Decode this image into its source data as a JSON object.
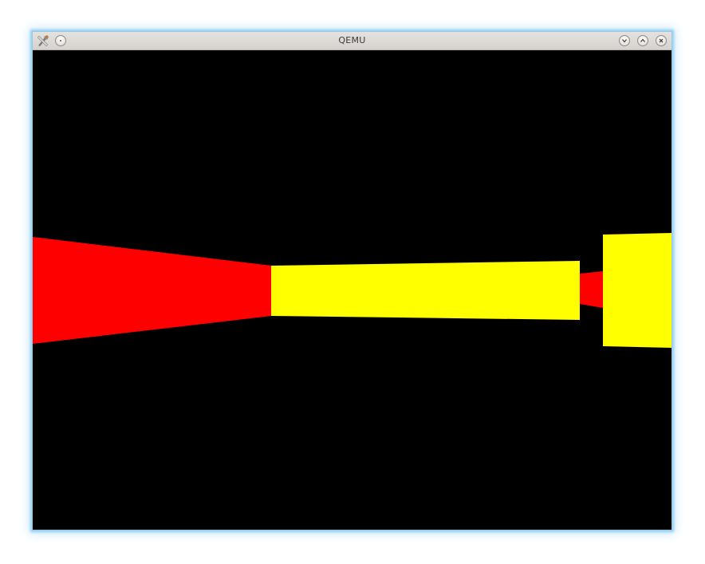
{
  "window": {
    "title": "QEMU"
  },
  "titlebar": {
    "app_icon": "qemu-tools-icon",
    "left_buttons": [
      {
        "name": "menu-button",
        "icon": "dot-icon"
      }
    ],
    "right_buttons": [
      {
        "name": "minimize-button",
        "icon": "chevron-down-icon"
      },
      {
        "name": "maximize-button",
        "icon": "chevron-up-icon"
      },
      {
        "name": "close-button",
        "icon": "close-icon"
      }
    ]
  },
  "scene": {
    "background_color": "#000000",
    "wall_colors": [
      "#ff0000",
      "#ffff00"
    ]
  }
}
